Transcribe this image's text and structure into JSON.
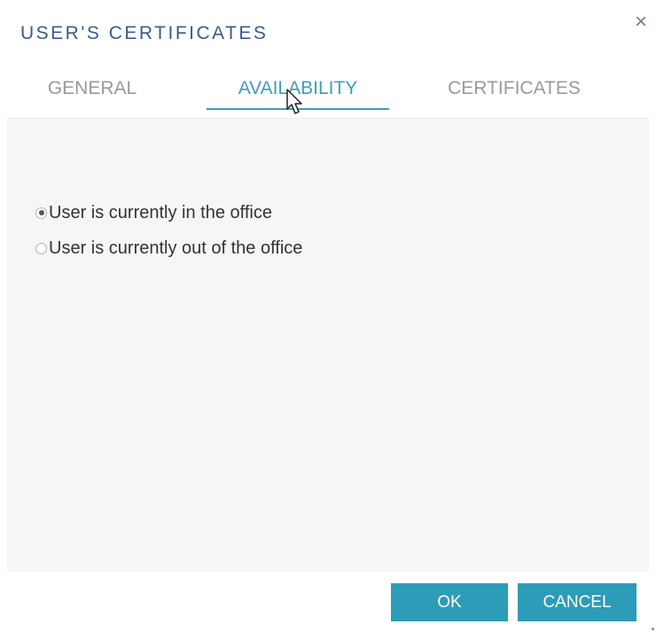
{
  "dialog": {
    "title": "USER'S CERTIFICATES",
    "close_glyph": "×"
  },
  "tabs": [
    {
      "label": "GENERAL",
      "active": false
    },
    {
      "label": "AVAILABILITY",
      "active": true
    },
    {
      "label": "CERTIFICATES",
      "active": false
    }
  ],
  "availability": {
    "options": [
      {
        "label": "User is currently in the office",
        "checked": true
      },
      {
        "label": "User is currently out of the office",
        "checked": false
      }
    ]
  },
  "footer": {
    "ok_label": "OK",
    "cancel_label": "CANCEL"
  },
  "colors": {
    "accent": "#2d9cb8",
    "title": "#3a5a8c",
    "tab_inactive": "#9a9a9a",
    "content_bg": "#f6f6f6"
  }
}
